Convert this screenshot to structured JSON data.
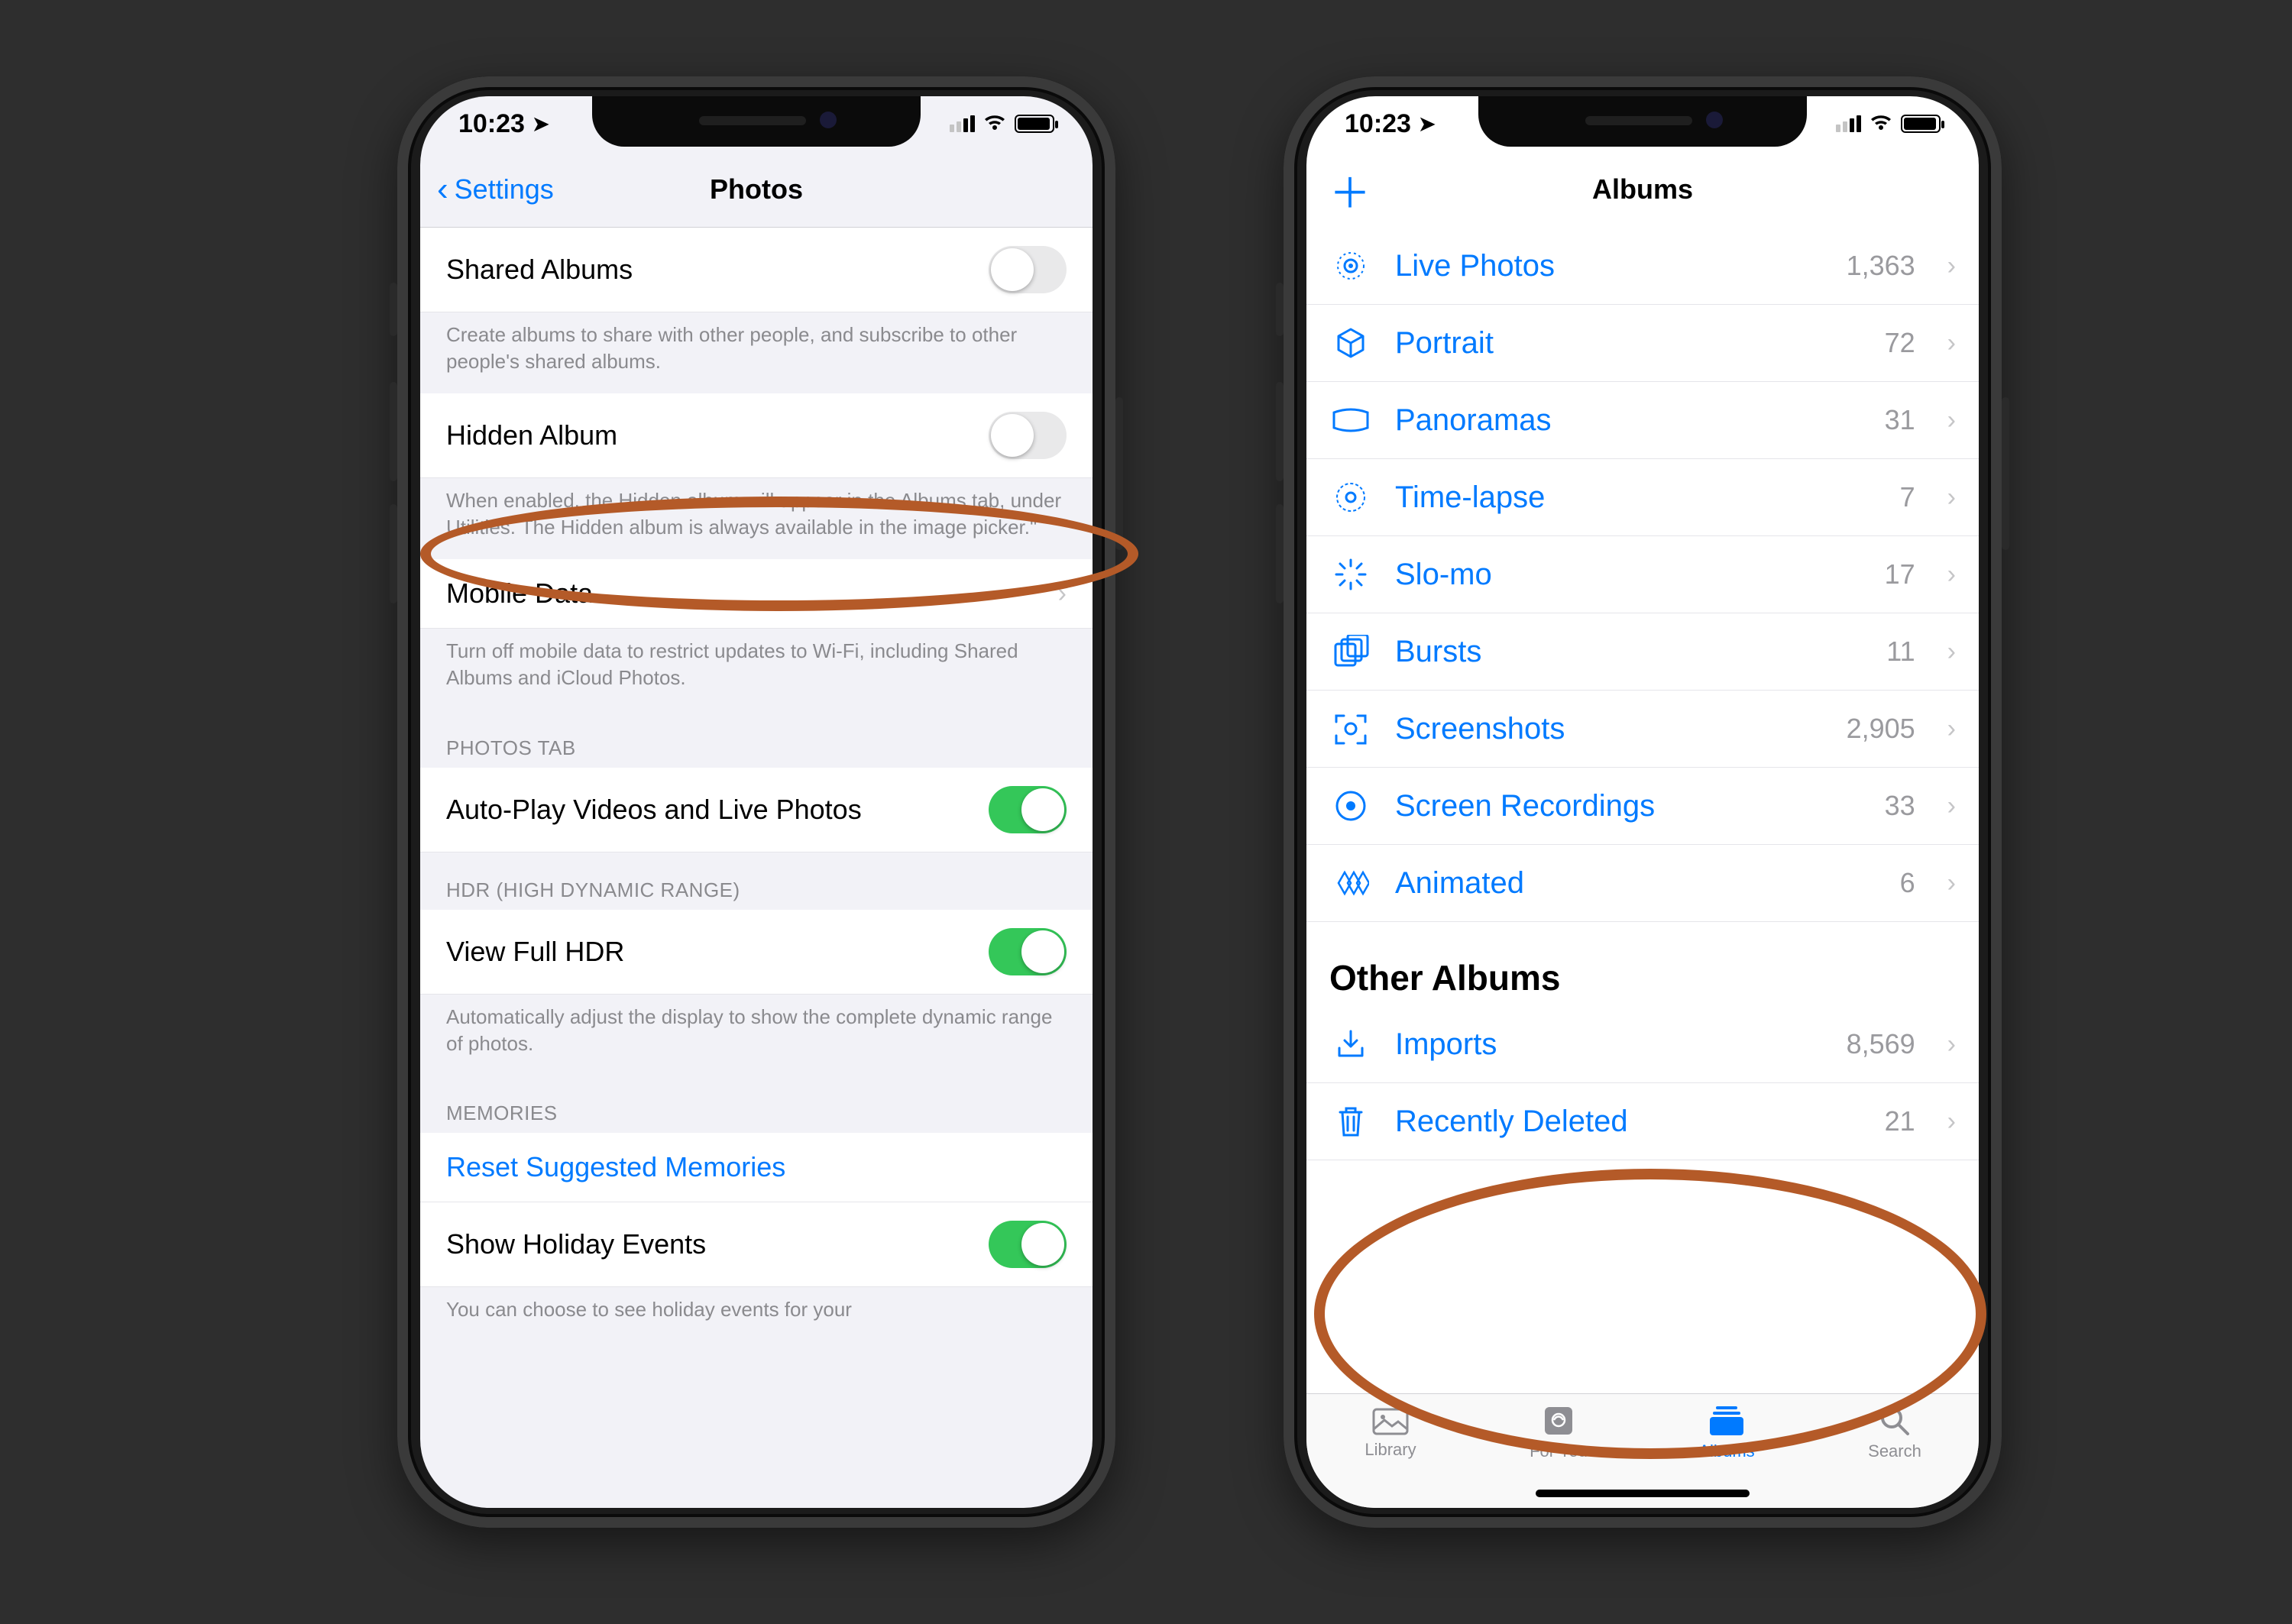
{
  "status": {
    "time": "10:23"
  },
  "left": {
    "back_label": "Settings",
    "title": "Photos",
    "shared_albums": {
      "label": "Shared Albums",
      "on": false
    },
    "shared_foot": "Create albums to share with other people, and subscribe to other people's shared albums.",
    "hidden_album": {
      "label": "Hidden Album",
      "on": false
    },
    "hidden_foot": "When enabled, the Hidden album will appear in the Albums tab, under Utilities. The Hidden album is always available in the image picker.\"",
    "mobile_data": {
      "label": "Mobile Data"
    },
    "mobile_foot": "Turn off mobile data to restrict updates to Wi-Fi, including Shared Albums and iCloud Photos.",
    "photos_tab_header": "PHOTOS TAB",
    "autoplay": {
      "label": "Auto-Play Videos and Live Photos",
      "on": true
    },
    "hdr_header": "HDR (HIGH DYNAMIC RANGE)",
    "hdr": {
      "label": "View Full HDR",
      "on": true
    },
    "hdr_foot": "Automatically adjust the display to show the complete dynamic range of photos.",
    "memories_header": "MEMORIES",
    "reset_mem": "Reset Suggested Memories",
    "holiday": {
      "label": "Show Holiday Events",
      "on": true
    },
    "holiday_foot": "You can choose to see holiday events for your"
  },
  "right": {
    "title": "Albums",
    "albums": [
      {
        "name": "Live Photos",
        "count": "1,363",
        "icon": "livephotos"
      },
      {
        "name": "Portrait",
        "count": "72",
        "icon": "cube"
      },
      {
        "name": "Panoramas",
        "count": "31",
        "icon": "panorama"
      },
      {
        "name": "Time-lapse",
        "count": "7",
        "icon": "timelapse"
      },
      {
        "name": "Slo-mo",
        "count": "17",
        "icon": "slomo"
      },
      {
        "name": "Bursts",
        "count": "11",
        "icon": "bursts"
      },
      {
        "name": "Screenshots",
        "count": "2,905",
        "icon": "screenshot"
      },
      {
        "name": "Screen Recordings",
        "count": "33",
        "icon": "recording"
      },
      {
        "name": "Animated",
        "count": "6",
        "icon": "animated"
      }
    ],
    "other_header": "Other Albums",
    "other": [
      {
        "name": "Imports",
        "count": "8,569",
        "icon": "import"
      },
      {
        "name": "Recently Deleted",
        "count": "21",
        "icon": "trash"
      }
    ],
    "tabs": {
      "library": "Library",
      "foryou": "For You",
      "albums": "Albums",
      "search": "Search"
    }
  }
}
